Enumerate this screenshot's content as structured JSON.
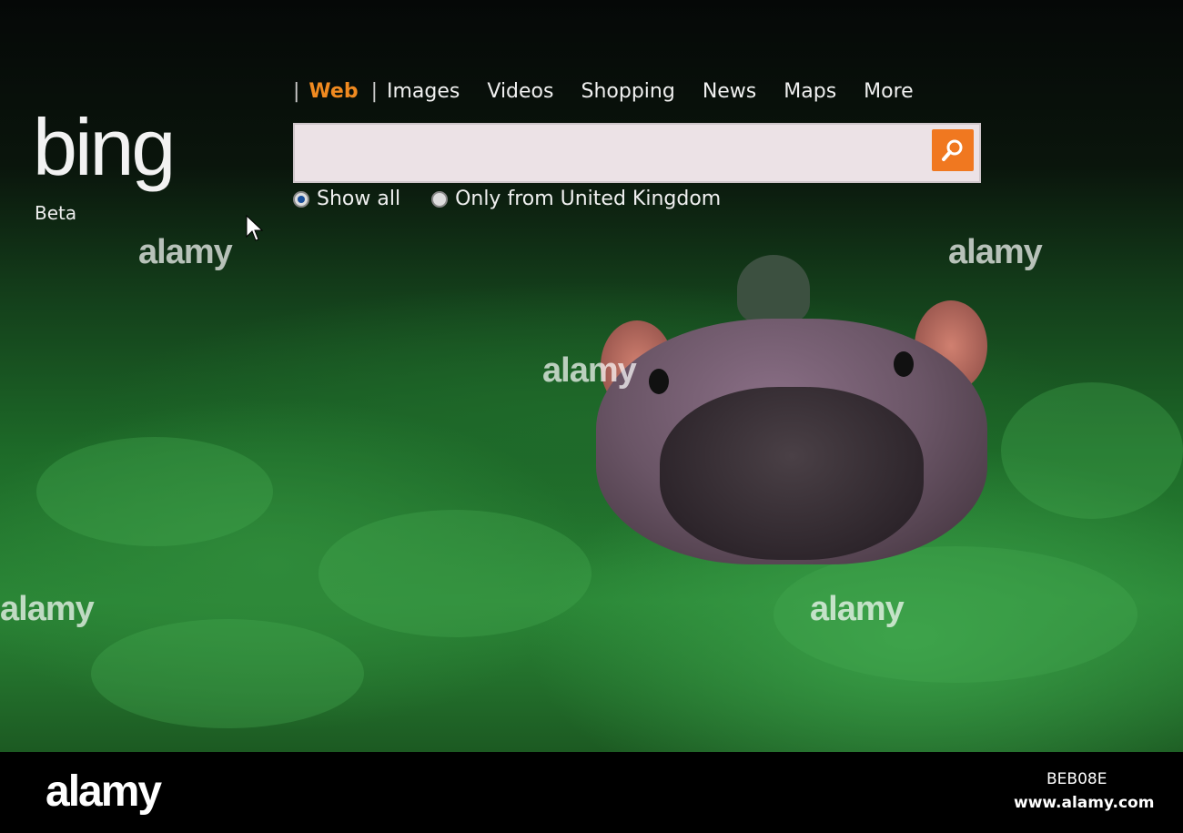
{
  "logo": {
    "text": "bing",
    "subtitle": "Beta"
  },
  "nav": {
    "items": [
      "Web",
      "Images",
      "Videos",
      "Shopping",
      "News",
      "Maps",
      "More"
    ],
    "active": "Web"
  },
  "search": {
    "value": "",
    "placeholder": ""
  },
  "radios": [
    {
      "label": "Show all",
      "checked": true
    },
    {
      "label": "Only from United Kingdom",
      "checked": false
    }
  ],
  "colors": {
    "accent": "#f08a20",
    "search_button": "#f07820"
  },
  "watermark": {
    "text": "alamy",
    "image_id": "BEB08E",
    "url": "www.alamy.com"
  }
}
